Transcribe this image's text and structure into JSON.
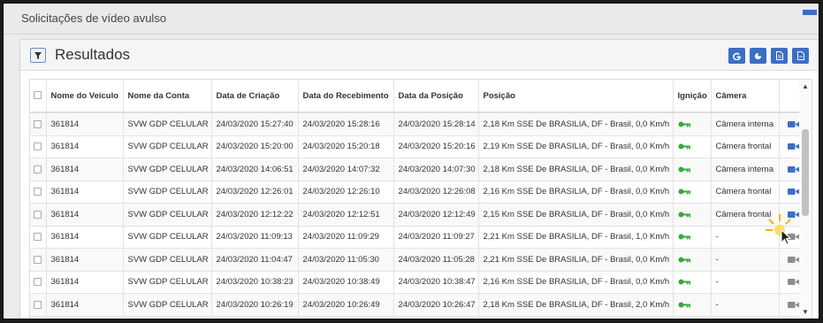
{
  "page": {
    "title": "Solicitações de vídeo avulso"
  },
  "panel": {
    "title": "Resultados",
    "filter_icon": "filter-icon",
    "buttons": [
      {
        "name": "refresh-button",
        "icon": "g-letter-icon"
      },
      {
        "name": "chart-button",
        "icon": "pie-chart-icon"
      },
      {
        "name": "export-button",
        "icon": "file-icon"
      },
      {
        "name": "pdf-button",
        "icon": "file-icon"
      }
    ]
  },
  "table": {
    "headers": [
      "Nome do Veículo",
      "Nome da Conta",
      "Data de Criação",
      "Data do Recebimento",
      "Data da Posição",
      "Posição",
      "Ignição",
      "Câmera"
    ],
    "rows": [
      {
        "vehicle": "361814",
        "account": "SVW GDP CELULAR",
        "created": "24/03/2020 15:27:40",
        "received": "24/03/2020 15:28:16",
        "position_date": "24/03/2020 15:28:14",
        "position": "2,18 Km SSE De BRASILIA, DF - Brasil, 0,0 Km/h",
        "camera": "Câmera interna",
        "ignition_on": true,
        "video_available": true
      },
      {
        "vehicle": "361814",
        "account": "SVW GDP CELULAR",
        "created": "24/03/2020 15:20:00",
        "received": "24/03/2020 15:20:18",
        "position_date": "24/03/2020 15:20:16",
        "position": "2,19 Km SSE De BRASILIA, DF - Brasil, 0,0 Km/h",
        "camera": "Câmera frontal",
        "ignition_on": true,
        "video_available": true
      },
      {
        "vehicle": "361814",
        "account": "SVW GDP CELULAR",
        "created": "24/03/2020 14:06:51",
        "received": "24/03/2020 14:07:32",
        "position_date": "24/03/2020 14:07:30",
        "position": "2,18 Km SSE De BRASILIA, DF - Brasil, 0,0 Km/h",
        "camera": "Câmera interna",
        "ignition_on": true,
        "video_available": true
      },
      {
        "vehicle": "361814",
        "account": "SVW GDP CELULAR",
        "created": "24/03/2020 12:26:01",
        "received": "24/03/2020 12:26:10",
        "position_date": "24/03/2020 12:26:08",
        "position": "2,16 Km SSE De BRASILIA, DF - Brasil, 0,0 Km/h",
        "camera": "Câmera frontal",
        "ignition_on": true,
        "video_available": true
      },
      {
        "vehicle": "361814",
        "account": "SVW GDP CELULAR",
        "created": "24/03/2020 12:12:22",
        "received": "24/03/2020 12:12:51",
        "position_date": "24/03/2020 12:12:49",
        "position": "2,15 Km SSE De BRASILIA, DF - Brasil, 0,0 Km/h",
        "camera": "Câmera frontal",
        "ignition_on": true,
        "video_available": true
      },
      {
        "vehicle": "361814",
        "account": "SVW GDP CELULAR",
        "created": "24/03/2020 11:09:13",
        "received": "24/03/2020 11:09:29",
        "position_date": "24/03/2020 11:09:27",
        "position": "2,21 Km SSE De BRASILIA, DF - Brasil, 1,0 Km/h",
        "camera": "-",
        "ignition_on": true,
        "video_available": false
      },
      {
        "vehicle": "361814",
        "account": "SVW GDP CELULAR",
        "created": "24/03/2020 11:04:47",
        "received": "24/03/2020 11:05:30",
        "position_date": "24/03/2020 11:05:28",
        "position": "2,21 Km SSE De BRASILIA, DF - Brasil, 0,0 Km/h",
        "camera": "-",
        "ignition_on": true,
        "video_available": false
      },
      {
        "vehicle": "361814",
        "account": "SVW GDP CELULAR",
        "created": "24/03/2020 10:38:23",
        "received": "24/03/2020 10:38:49",
        "position_date": "24/03/2020 10:38:47",
        "position": "2,16 Km SSE De BRASILIA, DF - Brasil, 0,0 Km/h",
        "camera": "-",
        "ignition_on": true,
        "video_available": false
      },
      {
        "vehicle": "361814",
        "account": "SVW GDP CELULAR",
        "created": "24/03/2020 10:26:19",
        "received": "24/03/2020 10:26:49",
        "position_date": "24/03/2020 10:26:47",
        "position": "2,18 Km SSE De BRASILIA, DF - Brasil, 2,0 Km/h",
        "camera": "-",
        "ignition_on": true,
        "video_available": false
      }
    ]
  },
  "colors": {
    "accent": "#3b6fc4",
    "ignition_on": "#3aa83a",
    "video_available": "#3a6fc6",
    "video_unavailable": "#8c8c8c"
  }
}
